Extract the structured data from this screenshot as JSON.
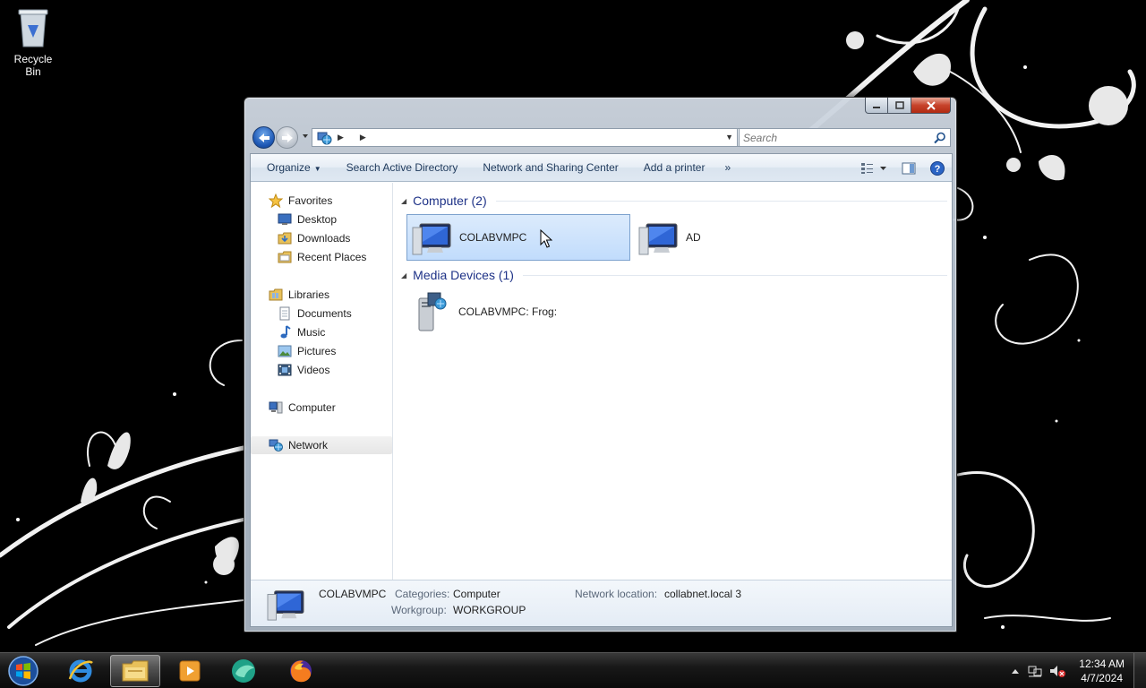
{
  "desktop": {
    "recycle_bin_label": "Recycle Bin"
  },
  "window": {
    "search_placeholder": "Search",
    "toolbar": {
      "organize": "Organize",
      "search_ad": "Search Active Directory",
      "network_sharing": "Network and Sharing Center",
      "add_printer": "Add a printer",
      "more": "»"
    },
    "nav": {
      "favorites": "Favorites",
      "desktop": "Desktop",
      "downloads": "Downloads",
      "recent": "Recent Places",
      "libraries": "Libraries",
      "documents": "Documents",
      "music": "Music",
      "pictures": "Pictures",
      "videos": "Videos",
      "computer": "Computer",
      "network": "Network"
    },
    "groups": {
      "computer": {
        "title": "Computer (2)",
        "items": [
          "COLABVMPC",
          "AD"
        ]
      },
      "media": {
        "title": "Media Devices (1)",
        "items": [
          "COLABVMPC: Frog:"
        ]
      }
    },
    "details": {
      "name": "COLABVMPC",
      "categories_label": "Categories:",
      "categories_value": "Computer",
      "workgroup_label": "Workgroup:",
      "workgroup_value": "WORKGROUP",
      "network_location_label": "Network location:",
      "network_location_value": "collabnet.local  3"
    }
  },
  "taskbar": {
    "time": "12:34 AM",
    "date": "4/7/2024"
  },
  "colors": {
    "accent": "#1e3287",
    "selection": "#c1dcfc",
    "toolbar_text": "#1e395b"
  }
}
